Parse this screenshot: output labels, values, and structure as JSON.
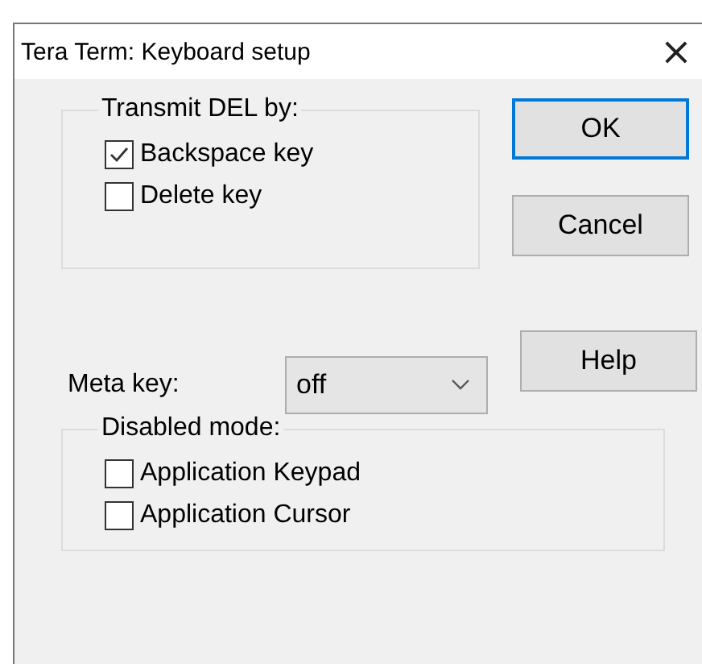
{
  "window": {
    "title": "Tera Term: Keyboard setup",
    "close": "×"
  },
  "transmit_group": {
    "title": "Transmit DEL by:",
    "options": [
      {
        "label": "Backspace key",
        "checked": true
      },
      {
        "label": "Delete key",
        "checked": false
      }
    ]
  },
  "buttons": [
    {
      "label": "OK",
      "default": true
    },
    {
      "label": "Cancel",
      "default": false
    },
    {
      "label": "Help",
      "default": false
    }
  ],
  "meta_key": {
    "label": "Meta key:",
    "value": "off"
  },
  "disabled_group": {
    "title": "Disabled mode:",
    "options": [
      {
        "label": "Application Keypad",
        "checked": false
      },
      {
        "label": "Application Cursor",
        "checked": false
      }
    ]
  }
}
